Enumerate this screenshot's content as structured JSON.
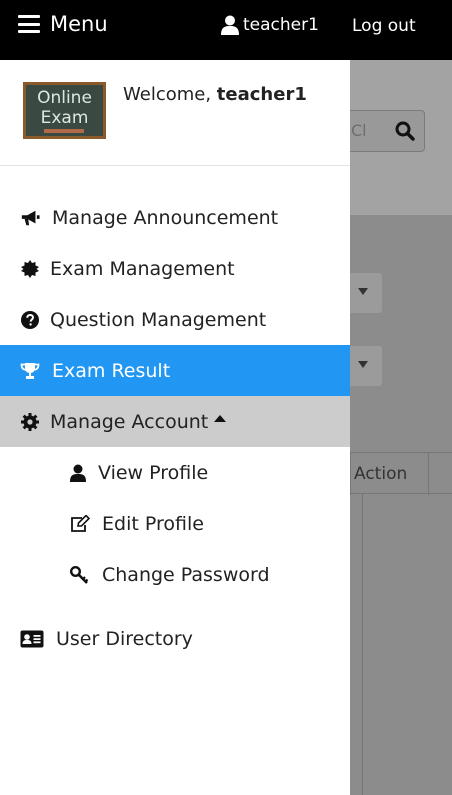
{
  "topbar": {
    "menu_label": "Menu",
    "username": "teacher1",
    "logout_label": "Log out"
  },
  "profile": {
    "logo_line1": "Online",
    "logo_line2": "Exam",
    "welcome_prefix": "Welcome,",
    "welcome_user": "teacher1"
  },
  "nav": {
    "items": [
      {
        "label": "Manage Announcement",
        "icon": "bullhorn-icon"
      },
      {
        "label": "Exam Management",
        "icon": "certificate-icon"
      },
      {
        "label": "Question Management",
        "icon": "question-circle-icon"
      },
      {
        "label": "Exam Result",
        "icon": "trophy-icon",
        "active": true
      },
      {
        "label": "Manage Account",
        "icon": "gear-icon",
        "expanded": true
      }
    ],
    "submenu": [
      {
        "label": "View Profile",
        "icon": "user-icon"
      },
      {
        "label": "Edit Profile",
        "icon": "edit-icon"
      },
      {
        "label": "Change Password",
        "icon": "key-icon"
      }
    ],
    "directory": {
      "label": "User Directory",
      "icon": "address-card-icon"
    }
  },
  "background": {
    "search_placeholder": "Cl",
    "table_header_action": "Action"
  },
  "colors": {
    "topbar": "#000000",
    "active": "#2196f3",
    "expanded": "#cccccc",
    "overlay": "#8c8c8c"
  }
}
